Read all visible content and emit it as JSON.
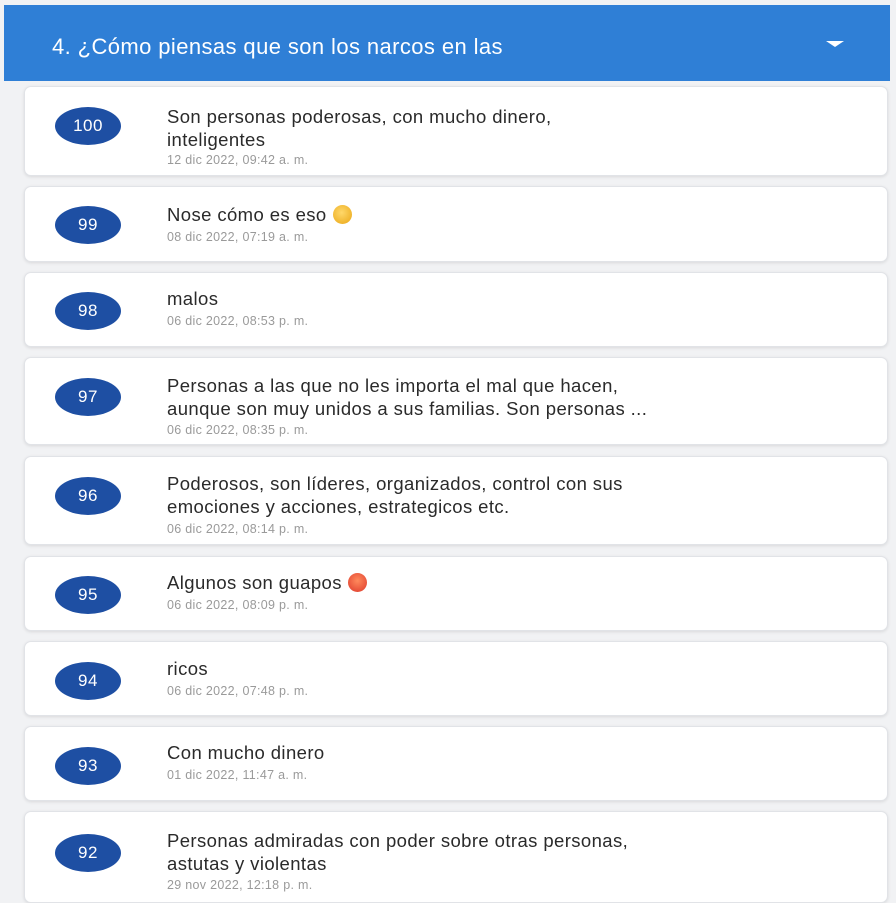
{
  "header": {
    "title": "4. ¿Cómo piensas que son los narcos en las",
    "title_overflow": ""
  },
  "responses": [
    {
      "number": "100",
      "lines": [
        "Son personas poderosas, con mucho dinero,",
        "inteligentes"
      ],
      "date": "12 dic 2022, 09:42 a. m.",
      "emoji": ""
    },
    {
      "number": "99",
      "lines": [
        "Nose cómo es eso"
      ],
      "date": "08 dic 2022, 07:19 a. m.",
      "emoji": "rolling-on-floor-laughing-emoji"
    },
    {
      "number": "98",
      "lines": [
        "malos"
      ],
      "date": "06 dic 2022, 08:53 p. m.",
      "emoji": ""
    },
    {
      "number": "97",
      "lines": [
        "Personas a las que no les importa el mal que hacen,",
        "aunque son muy unidos a sus familias. Son personas ..."
      ],
      "date": "06 dic 2022, 08:35 p. m.",
      "emoji": ""
    },
    {
      "number": "96",
      "lines": [
        "Poderosos, son líderes, organizados, control con sus",
        "emociones y  acciones, estrategicos etc."
      ],
      "date": "06 dic 2022, 08:14 p. m.",
      "emoji": ""
    },
    {
      "number": "95",
      "lines": [
        "Algunos son guapos"
      ],
      "date": "06 dic 2022, 08:09 p. m.",
      "emoji": "astonished-face-emoji"
    },
    {
      "number": "94",
      "lines": [
        "ricos"
      ],
      "date": "06 dic 2022, 07:48 p. m.",
      "emoji": ""
    },
    {
      "number": "93",
      "lines": [
        "Con mucho dinero"
      ],
      "date": "01 dic 2022, 11:47 a. m.",
      "emoji": ""
    },
    {
      "number": "92",
      "lines": [
        "Personas admiradas con poder sobre otras personas,",
        "astutas y violentas"
      ],
      "date": "29 nov 2022, 12:18 p. m.",
      "emoji": ""
    }
  ],
  "colors": {
    "header_bg": "#2f7fd6",
    "badge_bg": "#1e4fa3",
    "page_bg": "#f1f2f4"
  }
}
